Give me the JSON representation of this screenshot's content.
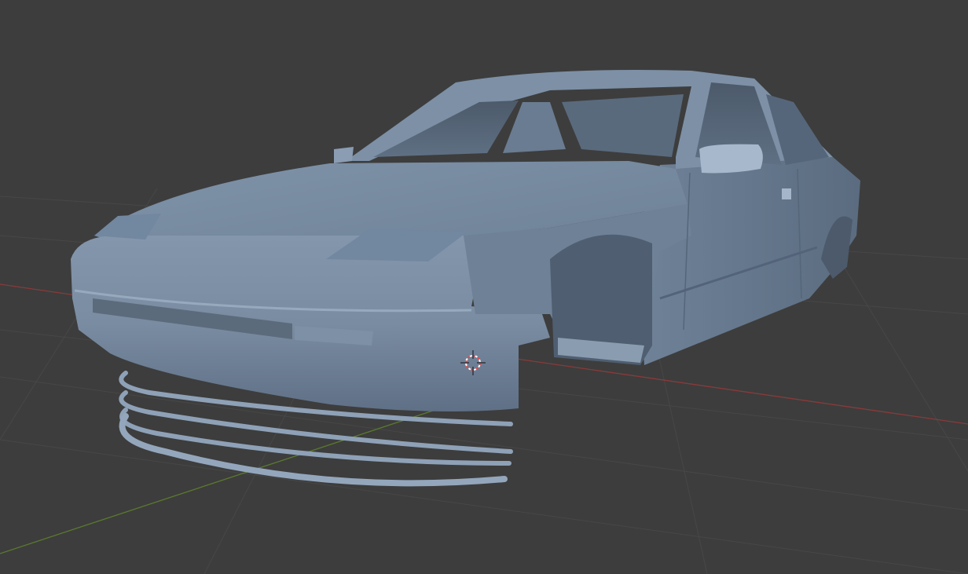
{
  "viewport": {
    "background_color": "#3d3d3d",
    "grid_color": "#4a4a4a",
    "x_axis_color": "#8a3a3a",
    "y_axis_color": "#5a7a2e",
    "model_color": "#8a9db3",
    "cursor_icon": "3d-cursor-icon"
  }
}
